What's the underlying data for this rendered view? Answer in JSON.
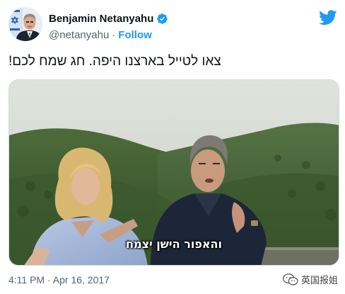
{
  "author": {
    "display_name": "Benjamin Netanyahu",
    "handle": "@netanyahu",
    "separator": "·",
    "follow_label": "Follow",
    "verified_icon": "verified-badge-icon",
    "avatar": "profile-avatar"
  },
  "brand": {
    "icon": "twitter-bird-icon",
    "color": "#1d9bf0"
  },
  "tweet": {
    "text": "צאו לטייל בארצנו היפה. חג שמח לכם!",
    "timestamp": "4:11 PM · Apr 16, 2017"
  },
  "media": {
    "type": "video-frame",
    "subtitle": "והאפור הישן יצמח"
  },
  "watermark": {
    "icon": "wechat-icon",
    "text": "英国报姐"
  }
}
